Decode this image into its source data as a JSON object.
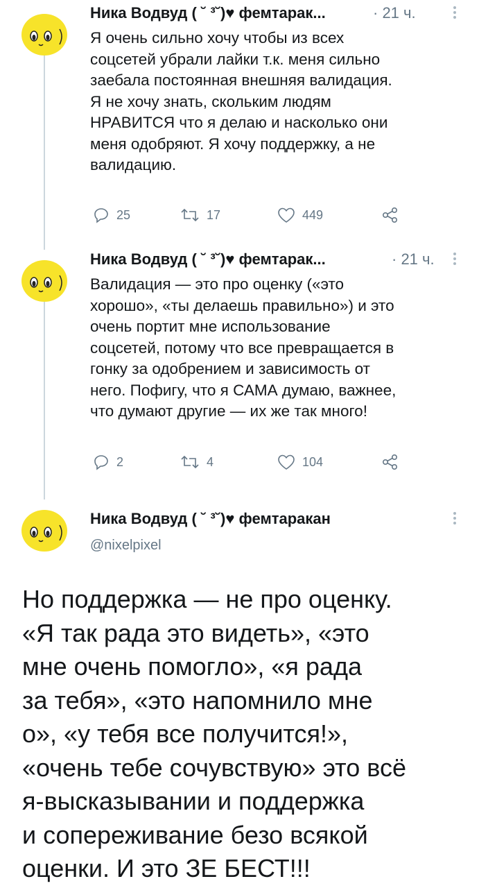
{
  "tweets": [
    {
      "author": "Ника Водвуд ( ˘ ³˘)♥ фемтарак...",
      "time": "· 21 ч.",
      "text": "Я очень сильно хочу чтобы из всех\nсоцсетей убрали лайки т.к. меня сильно\nзаебала постоянная внешняя валидация.\nЯ не хочу знать, скольким людям\nНРАВИТСЯ что я делаю и насколько они\nменя одобряют. Я хочу поддержку, а не\nвалидацию.",
      "replies": "25",
      "retweets": "17",
      "likes": "449"
    },
    {
      "author": "Ника Водвуд ( ˘ ³˘)♥ фемтарак...",
      "time": "· 21 ч.",
      "text": "Валидация — это про оценку («это\nхорошо», «ты делаешь правильно») и это\nочень портит мне использование\nсоцсетей, потому что все превращается в\nгонку за одобрением и зависимость от\nнего. Пофигу, что я САМА думаю, важнее,\nчто думают другие — их же так много!",
      "replies": "2",
      "retweets": "4",
      "likes": "104"
    }
  ],
  "main_tweet": {
    "author": "Ника Водвуд ( ˘ ³˘)♥ фемтаракан",
    "handle": "@nixelpixel",
    "text": "Но поддержка — не про оценку.\n«Я так рада это видеть», «это\nмне очень помогло», «я рада\nза тебя», «это напомнило мне\nо», «у тебя все получится!»,\n«очень тебе сочувствую» это всё\nя-высказывании и поддержка\nи сопереживание безо всякой\nоценки. И это ЗЕ БЕСТ!!!"
  },
  "colors": {
    "avatar_yellow": "#f7e32a",
    "thread_line": "#ccd6dd",
    "secondary_text": "#657786"
  },
  "icons": [
    "avatar",
    "reply-icon",
    "retweet-icon",
    "like-icon",
    "share-icon",
    "more-icon"
  ]
}
